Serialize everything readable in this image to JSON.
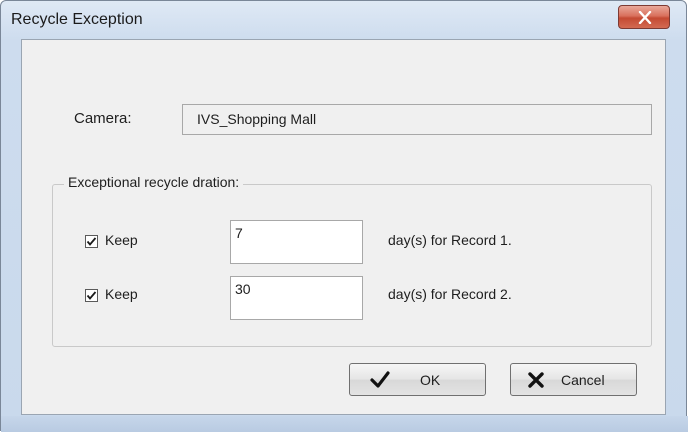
{
  "window": {
    "title": "Recycle Exception",
    "close_label": "x"
  },
  "camera": {
    "label": "Camera:",
    "value": "IVS_Shopping Mall"
  },
  "group": {
    "title": "Exceptional recycle dration:"
  },
  "rows": [
    {
      "checked": true,
      "keep_label": "Keep",
      "days_value": "7",
      "suffix": "day(s) for Record 1."
    },
    {
      "checked": true,
      "keep_label": "Keep",
      "days_value": "30",
      "suffix": "day(s) for Record 2."
    }
  ],
  "buttons": {
    "ok_label": "OK",
    "cancel_label": "Cancel"
  },
  "icons": {
    "close": "close-icon",
    "checkmark": "checkmark-icon",
    "cancel_x": "x-icon"
  }
}
